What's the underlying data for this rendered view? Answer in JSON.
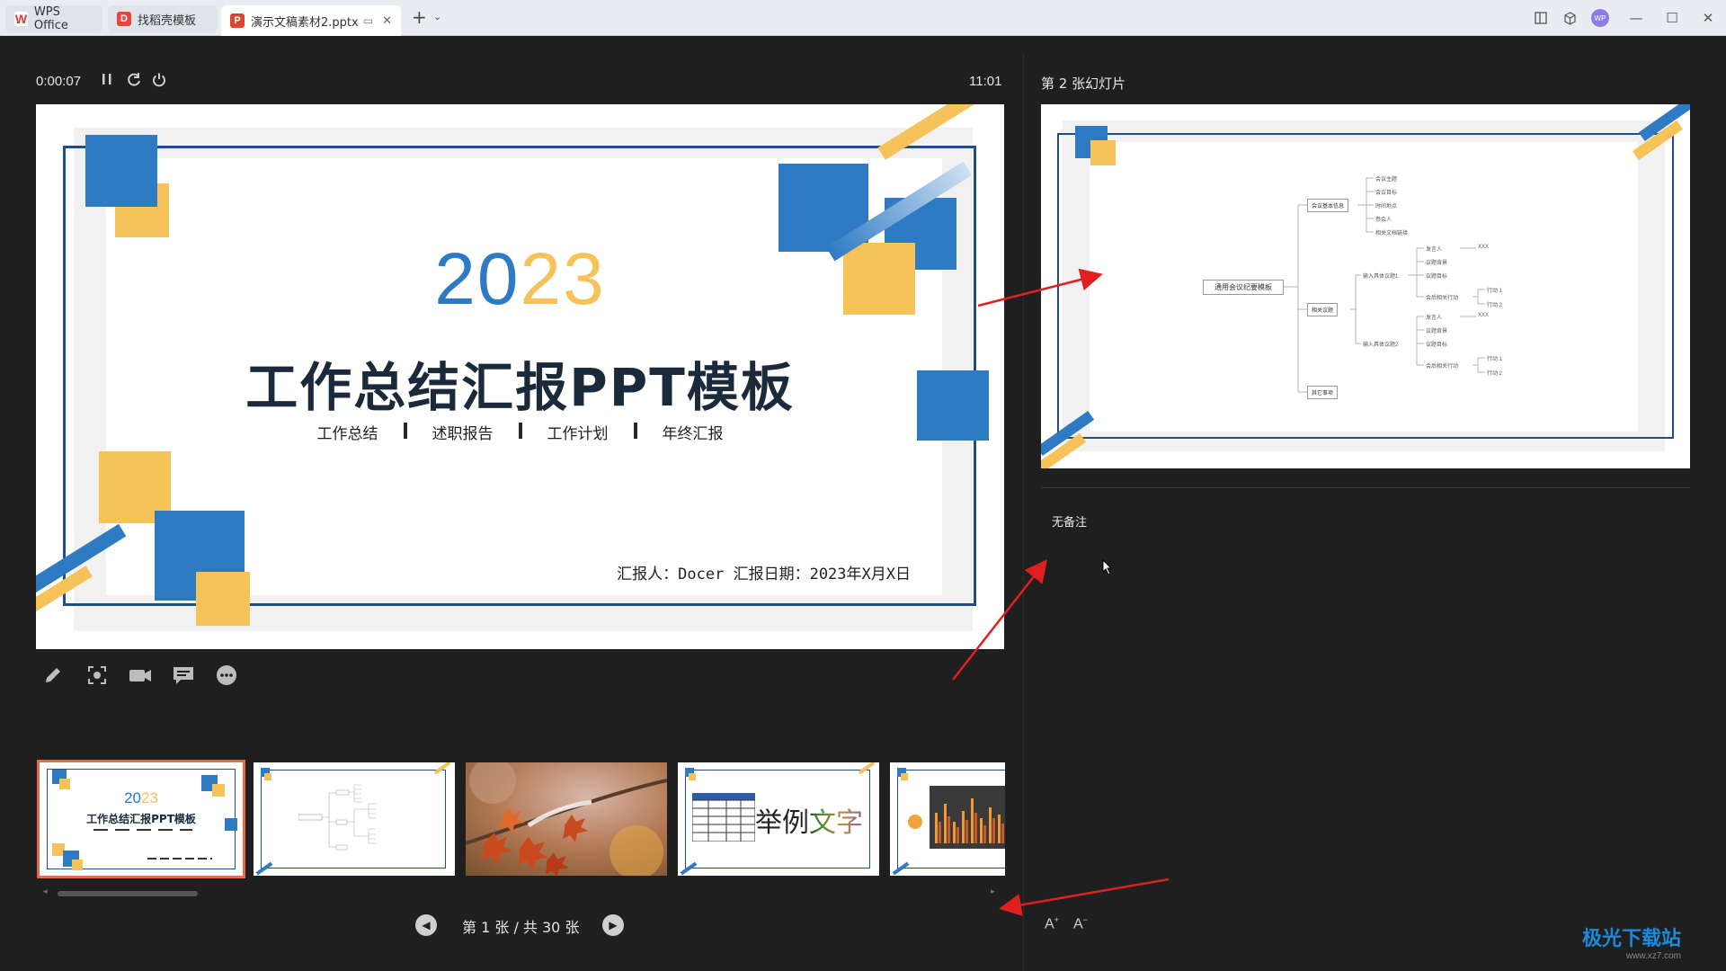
{
  "tabs": [
    {
      "label": "WPS Office",
      "icon": "wps-logo-icon"
    },
    {
      "label": "找稻壳模板",
      "icon": "docer-logo-icon"
    },
    {
      "label": "演示文稿素材2.pptx",
      "icon": "ppt-file-icon",
      "active": true
    }
  ],
  "topbar_right": {
    "avatar_text": "WP"
  },
  "presenter": {
    "elapsed": "0:00:07",
    "clock": "11:01",
    "next_label": "第 2 张幻灯片",
    "notes": "无备注",
    "page_indicator": "第 1 张 / 共 30 张"
  },
  "current_slide": {
    "year_blue": "20",
    "year_yellow": "23",
    "title": "工作总结汇报PPT模板",
    "subtitles": [
      "工作总结",
      "述职报告",
      "工作计划",
      "年终汇报"
    ],
    "reporter": "汇报人：Docer  汇报日期：2023年X月X日"
  },
  "next_slide": {
    "root": "通用会议纪要模板",
    "branches": [
      "会议基本信息",
      "相关议题",
      "其它事项"
    ],
    "info_items": [
      "会议主题",
      "会议目标",
      "时间地点",
      "参会人",
      "相关文档链接"
    ],
    "topic_items": [
      "输入具体议题1",
      "输入具体议题2"
    ],
    "detail_items": [
      "发言人",
      "议题背景",
      "议题目标",
      "会后相关行动"
    ],
    "xxx": "XXX",
    "actions": [
      "行动 1",
      "行动 2"
    ]
  },
  "thumbnails": [
    {
      "index": 1,
      "year_blue": "20",
      "year_yellow": "23",
      "title": "工作总结汇报PPT模板"
    },
    {
      "index": 2
    },
    {
      "index": 3
    },
    {
      "index": 4,
      "text": "举例文字"
    },
    {
      "index": 5
    }
  ],
  "colors": {
    "accent_blue": "#2e7bc4",
    "accent_yellow": "#f6c25a",
    "selected_outline": "#e46b45"
  },
  "watermark": {
    "logo": "极光下载站",
    "url": "www.xz7.com"
  }
}
